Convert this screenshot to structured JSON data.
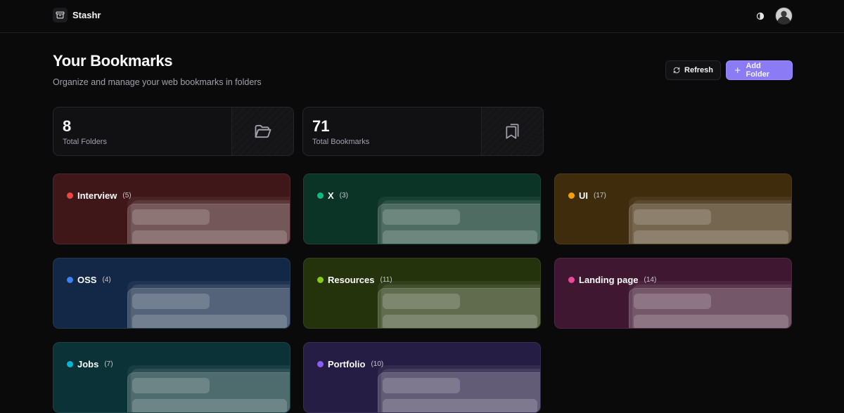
{
  "app": {
    "name": "Stashr"
  },
  "header": {
    "title": "Your Bookmarks",
    "subtitle": "Organize and manage your web bookmarks in folders"
  },
  "actions": {
    "refresh_label": "Refresh",
    "add_folder_label": "Add Folder"
  },
  "stats": [
    {
      "value": "8",
      "label": "Total Folders",
      "icon": "folder-icon"
    },
    {
      "value": "71",
      "label": "Total Bookmarks",
      "icon": "bookmarks-icon"
    }
  ],
  "folders": [
    {
      "name": "Interview",
      "count": "(5)",
      "dot_color": "#ef4444",
      "bg_color": "#3f1718"
    },
    {
      "name": "X",
      "count": "(3)",
      "dot_color": "#10b981",
      "bg_color": "#0b3326"
    },
    {
      "name": "UI",
      "count": "(17)",
      "dot_color": "#f59e0b",
      "bg_color": "#3f2c0c"
    },
    {
      "name": "OSS",
      "count": "(4)",
      "dot_color": "#3b82f6",
      "bg_color": "#132847"
    },
    {
      "name": "Resources",
      "count": "(11)",
      "dot_color": "#84cc16",
      "bg_color": "#25330c"
    },
    {
      "name": "Landing page",
      "count": "(14)",
      "dot_color": "#ec4899",
      "bg_color": "#3f1730"
    },
    {
      "name": "Jobs",
      "count": "(7)",
      "dot_color": "#06b6d4",
      "bg_color": "#0b3236"
    },
    {
      "name": "Portfolio",
      "count": "(10)",
      "dot_color": "#8b5cf6",
      "bg_color": "#261d44"
    }
  ],
  "theme": {
    "accent": "#8b7cf6",
    "background": "#0a0a0b"
  }
}
